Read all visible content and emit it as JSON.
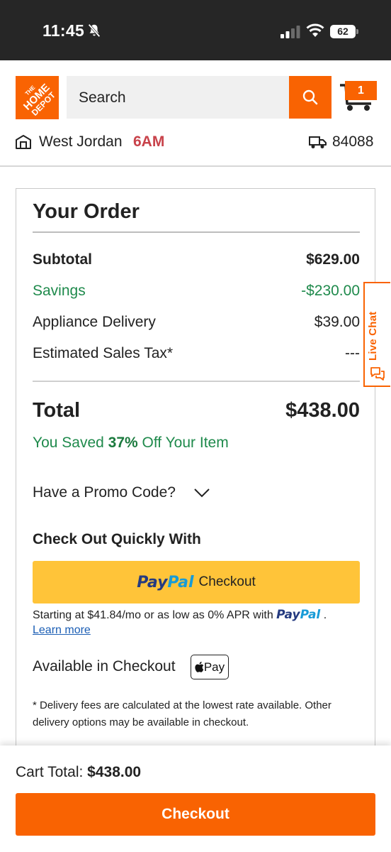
{
  "status_bar": {
    "time": "11:45",
    "battery": "62"
  },
  "header": {
    "logo_text": "THE HOME DEPOT",
    "search_placeholder": "Search",
    "cart_count": "1",
    "store_name": "West Jordan",
    "store_hours": "6AM",
    "zip": "84088"
  },
  "order": {
    "title": "Your Order",
    "lines": [
      {
        "label": "Subtotal",
        "value": "$629.00"
      },
      {
        "label": "Savings",
        "value": "-$230.00"
      },
      {
        "label": "Appliance Delivery",
        "value": "$39.00"
      },
      {
        "label": "Estimated Sales Tax*",
        "value": "---"
      }
    ],
    "total_label": "Total",
    "total_value": "$438.00",
    "saved_prefix": "You Saved ",
    "saved_percent": "37%",
    "saved_suffix": " Off Your Item",
    "promo_label": "Have a Promo Code?",
    "quick_title": "Check Out Quickly With",
    "paypal_pay": "Pay",
    "paypal_pal": "Pal",
    "paypal_checkout": "Checkout",
    "apr_text": "Starting at $41.84/mo or as low as 0% APR with ",
    "apr_suffix": " .",
    "learn_more": "Learn more",
    "available_text": "Available in Checkout",
    "applepay_label": "Pay",
    "note": "* Delivery fees are calculated at the lowest rate available. Other delivery options may be available in checkout."
  },
  "live_chat": "Live Chat",
  "footer": {
    "cart_total_label": "Cart Total: ",
    "cart_total_value": "$438.00",
    "checkout_label": "Checkout"
  },
  "colors": {
    "brand": "#f96302",
    "savings": "#1f8a4c",
    "hours": "#c8424a",
    "paypal_button": "#ffc439"
  }
}
